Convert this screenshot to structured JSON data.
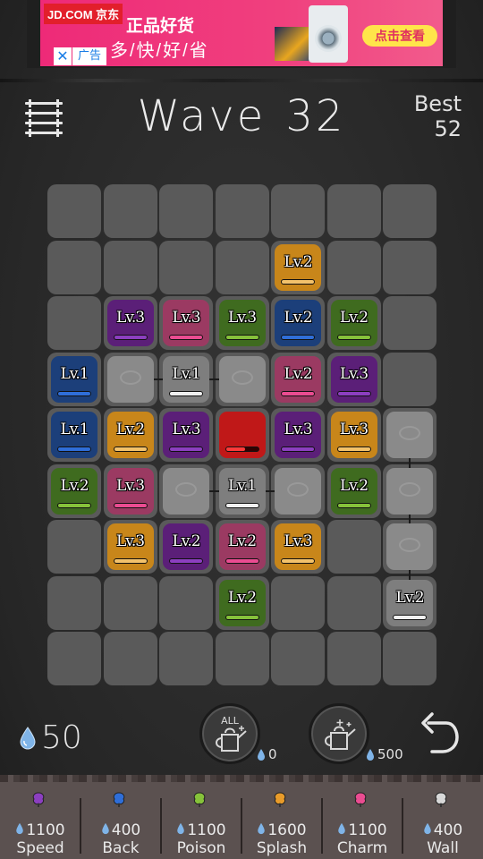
{
  "ad": {
    "logo": "JD.COM 京东",
    "title": "正品好货",
    "subtitle": "多/快/好/省",
    "cta": "点击查看",
    "tag": "广告",
    "close": "✕"
  },
  "header": {
    "wave_label": "Wave",
    "wave_value": "32",
    "best_label": "Best",
    "best_value": "52"
  },
  "board": {
    "tiles": [
      {
        "row": 1,
        "col": 4,
        "color": "orange",
        "level": "Lv.2"
      },
      {
        "row": 2,
        "col": 1,
        "color": "purple",
        "level": "Lv.3"
      },
      {
        "row": 2,
        "col": 2,
        "color": "pink",
        "level": "Lv.3"
      },
      {
        "row": 2,
        "col": 3,
        "color": "green",
        "level": "Lv.3"
      },
      {
        "row": 2,
        "col": 4,
        "color": "blue",
        "level": "Lv.2"
      },
      {
        "row": 2,
        "col": 5,
        "color": "green",
        "level": "Lv.2"
      },
      {
        "row": 3,
        "col": 0,
        "color": "blue",
        "level": "Lv.1"
      },
      {
        "row": 3,
        "col": 2,
        "color": "white",
        "level": "Lv.1"
      },
      {
        "row": 3,
        "col": 4,
        "color": "pink",
        "level": "Lv.2"
      },
      {
        "row": 3,
        "col": 5,
        "color": "purple",
        "level": "Lv.3"
      },
      {
        "row": 4,
        "col": 0,
        "color": "blue",
        "level": "Lv.1"
      },
      {
        "row": 4,
        "col": 1,
        "color": "orange",
        "level": "Lv.2"
      },
      {
        "row": 4,
        "col": 2,
        "color": "purple",
        "level": "Lv.3"
      },
      {
        "row": 4,
        "col": 3,
        "color": "red",
        "level": "",
        "health": 0.6
      },
      {
        "row": 4,
        "col": 4,
        "color": "purple",
        "level": "Lv.3"
      },
      {
        "row": 4,
        "col": 5,
        "color": "orange",
        "level": "Lv.3"
      },
      {
        "row": 5,
        "col": 0,
        "color": "green",
        "level": "Lv.2"
      },
      {
        "row": 5,
        "col": 1,
        "color": "pink",
        "level": "Lv.3"
      },
      {
        "row": 5,
        "col": 3,
        "color": "white",
        "level": "Lv.1"
      },
      {
        "row": 5,
        "col": 5,
        "color": "green",
        "level": "Lv.2"
      },
      {
        "row": 6,
        "col": 1,
        "color": "orange",
        "level": "Lv.3"
      },
      {
        "row": 6,
        "col": 2,
        "color": "purple",
        "level": "Lv.2"
      },
      {
        "row": 6,
        "col": 3,
        "color": "pink",
        "level": "Lv.2"
      },
      {
        "row": 6,
        "col": 4,
        "color": "orange",
        "level": "Lv.3"
      },
      {
        "row": 7,
        "col": 3,
        "color": "green",
        "level": "Lv.2"
      },
      {
        "row": 7,
        "col": 6,
        "color": "white",
        "level": "Lv.2"
      }
    ],
    "ghosts": [
      {
        "row": 3,
        "col": 1
      },
      {
        "row": 3,
        "col": 3
      },
      {
        "row": 4,
        "col": 6
      },
      {
        "row": 5,
        "col": 2
      },
      {
        "row": 5,
        "col": 4
      },
      {
        "row": 5,
        "col": 6
      },
      {
        "row": 6,
        "col": 6
      }
    ]
  },
  "controls": {
    "water": "50",
    "pot_all_label": "ALL",
    "pot_all_cost": "0",
    "pot_single_cost": "500"
  },
  "shop": [
    {
      "cost": "1100",
      "name": "Speed",
      "color": "#8c3fc0",
      "icon": "speed-plant-icon"
    },
    {
      "cost": "400",
      "name": "Back",
      "color": "#2f6ed8",
      "icon": "back-plant-icon"
    },
    {
      "cost": "1100",
      "name": "Poison",
      "color": "#86c23a",
      "icon": "poison-plant-icon"
    },
    {
      "cost": "1600",
      "name": "Splash",
      "color": "#e89b2a",
      "icon": "splash-plant-icon"
    },
    {
      "cost": "1100",
      "name": "Charm",
      "color": "#ea4c91",
      "icon": "charm-plant-icon"
    },
    {
      "cost": "400",
      "name": "Wall",
      "color": "#d8d8d8",
      "icon": "wall-plant-icon"
    }
  ]
}
